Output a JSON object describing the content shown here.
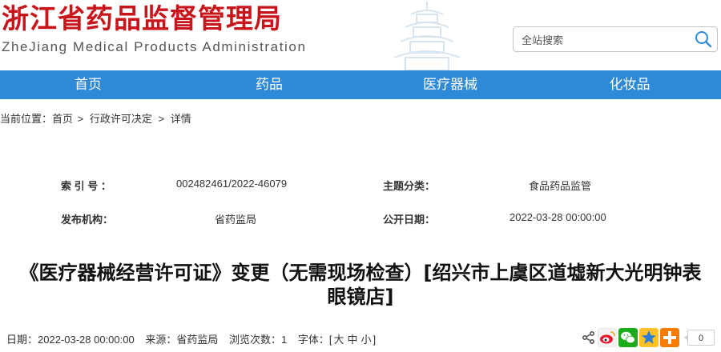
{
  "header": {
    "logo_cn": "浙江省药品监督管理局",
    "logo_en": "ZheJiang Medical Products Administration"
  },
  "search": {
    "placeholder": "全站搜索",
    "value": ""
  },
  "nav": {
    "items": [
      {
        "label": "首页"
      },
      {
        "label": "药品"
      },
      {
        "label": "医疗器械"
      },
      {
        "label": "化妆品"
      }
    ]
  },
  "breadcrumb": {
    "prefix": "当前位置：",
    "items": [
      {
        "label": "首页"
      },
      {
        "label": "行政许可决定"
      },
      {
        "label": "详情"
      }
    ],
    "separator": ">"
  },
  "meta": {
    "index_label": "索 引 号 ：",
    "index_value": "002482461/2022-46079",
    "topic_label": "主题分类：",
    "topic_value": "食品药品监管",
    "publisher_label": "发布机构：",
    "publisher_value": "省药监局",
    "date_label": "公开日期：",
    "date_value": "2022-03-28 00:00:00"
  },
  "article": {
    "title_line1": "《医疗器械经营许可证》变更（无需现场检查）[绍兴市上虞区道墟新大光明钟表",
    "title_line2": "眼镜店]",
    "date_text": "日期：2022-03-28 00:00:00",
    "source_text": "来源：省药监局",
    "views_text": "浏览次数：1",
    "font_label": "字体：[",
    "font_large": "大",
    "font_medium": "中",
    "font_small": "小",
    "font_close": "]"
  },
  "share": {
    "icons": [
      "share-icon",
      "weibo-icon",
      "wechat-icon",
      "qzone-icon",
      "more-icon"
    ],
    "count": "0"
  },
  "colors": {
    "brand_red": "#c8151b",
    "nav_blue": "#2e8ad9"
  }
}
